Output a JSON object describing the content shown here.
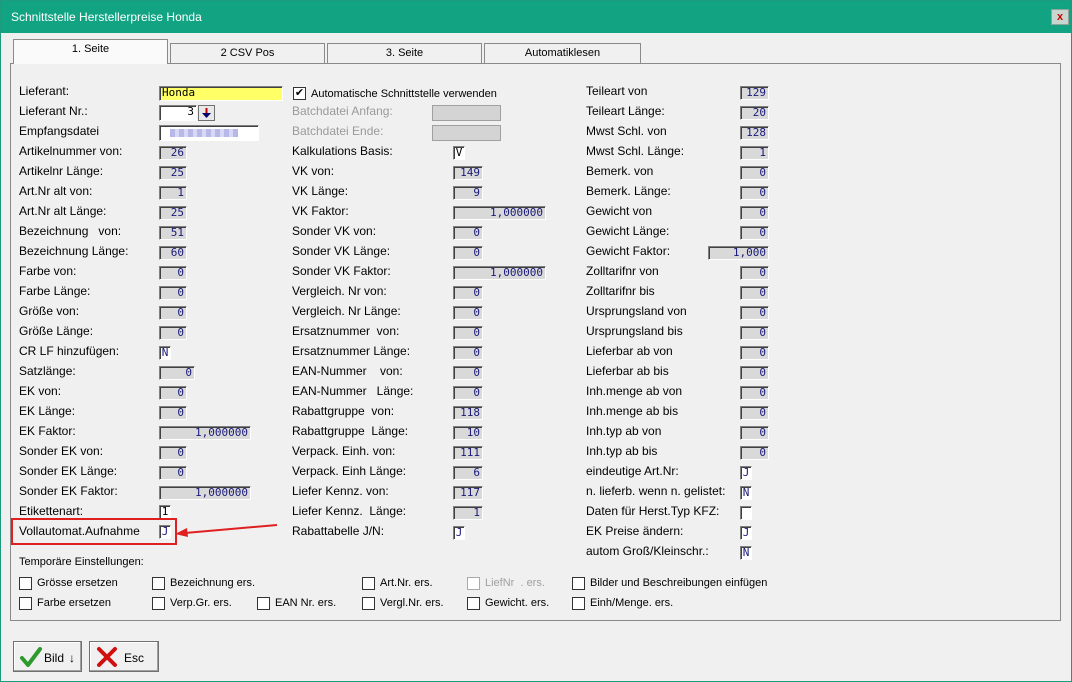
{
  "window": {
    "title": "Schnittstelle Herstellerpreise Honda",
    "close": "x"
  },
  "tabs": [
    "1. Seite",
    "2 CSV Pos",
    "3. Seite",
    "Automatiklesen"
  ],
  "col1": [
    {
      "label": "Lieferant:",
      "value": "Honda"
    },
    {
      "label": "Lieferant Nr.:",
      "value": "3"
    },
    {
      "label": "Empfangsdatei",
      "value": ""
    },
    {
      "label": "Artikelnummer von:",
      "value": "26"
    },
    {
      "label": "Artikelnr Länge:",
      "value": "25"
    },
    {
      "label": "Art.Nr alt von:",
      "value": "1"
    },
    {
      "label": "Art.Nr alt Länge:",
      "value": "25"
    },
    {
      "label": "Bezeichnung   von:",
      "value": "51"
    },
    {
      "label": "Bezeichnung Länge:",
      "value": "60"
    },
    {
      "label": "Farbe von:",
      "value": "0"
    },
    {
      "label": "Farbe Länge:",
      "value": "0"
    },
    {
      "label": "Größe von:",
      "value": "0"
    },
    {
      "label": "Größe Länge:",
      "value": "0"
    },
    {
      "label": "CR LF hinzufügen:",
      "value": "N"
    },
    {
      "label": "Satzlänge:",
      "value": "0"
    },
    {
      "label": "EK von:",
      "value": "0"
    },
    {
      "label": "EK Länge:",
      "value": "0"
    },
    {
      "label": "EK Faktor:",
      "value": "1,000000"
    },
    {
      "label": "Sonder EK von:",
      "value": "0"
    },
    {
      "label": "Sonder EK Länge:",
      "value": "0"
    },
    {
      "label": "Sonder EK Faktor:",
      "value": "1,000000"
    },
    {
      "label": "Etikettenart:",
      "value": "1"
    },
    {
      "label": "Vollautomat.Aufnahme",
      "value": "J"
    }
  ],
  "col2": {
    "auto_label": "Automatische Schnittstelle verwenden",
    "auto_checked": "✔",
    "batch_start": "Batchdatei Anfang:",
    "batch_end": "Batchdatei Ende:",
    "rows": [
      {
        "label": "Kalkulations Basis:",
        "value": "V"
      },
      {
        "label": "VK von:",
        "value": "149"
      },
      {
        "label": "VK Länge:",
        "value": "9"
      },
      {
        "label": "VK Faktor:",
        "value": "1,000000"
      },
      {
        "label": "Sonder VK von:",
        "value": "0"
      },
      {
        "label": "Sonder VK Länge:",
        "value": "0"
      },
      {
        "label": "Sonder VK Faktor:",
        "value": "1,000000"
      },
      {
        "label": "Vergleich. Nr von:",
        "value": "0"
      },
      {
        "label": "Vergleich. Nr Länge:",
        "value": "0"
      },
      {
        "label": "Ersatznummer  von:",
        "value": "0"
      },
      {
        "label": "Ersatznummer Länge:",
        "value": "0"
      },
      {
        "label": "EAN-Nummer    von:",
        "value": "0"
      },
      {
        "label": "EAN-Nummer   Länge:",
        "value": "0"
      },
      {
        "label": "Rabattgruppe  von:",
        "value": "118"
      },
      {
        "label": "Rabattgruppe  Länge:",
        "value": "10"
      },
      {
        "label": "Verpack. Einh. von:",
        "value": "111"
      },
      {
        "label": "Verpack. Einh Länge:",
        "value": "6"
      },
      {
        "label": "Liefer Kennz. von:",
        "value": "117"
      },
      {
        "label": "Liefer Kennz.  Länge:",
        "value": "1"
      },
      {
        "label": "Rabattabelle J/N:",
        "value": "J"
      }
    ]
  },
  "col3": [
    {
      "label": "Teileart von",
      "value": "129"
    },
    {
      "label": "Teileart Länge:",
      "value": "20"
    },
    {
      "label": "Mwst Schl. von",
      "value": "128"
    },
    {
      "label": "Mwst Schl. Länge:",
      "value": "1"
    },
    {
      "label": "Bemerk. von",
      "value": "0"
    },
    {
      "label": "Bemerk. Länge:",
      "value": "0"
    },
    {
      "label": "Gewicht von",
      "value": "0"
    },
    {
      "label": "Gewicht Länge:",
      "value": "0"
    },
    {
      "label": "Gewicht Faktor:",
      "value": "1,000"
    },
    {
      "label": "Zolltarifnr von",
      "value": "0"
    },
    {
      "label": "Zolltarifnr bis",
      "value": "0"
    },
    {
      "label": "Ursprungsland von",
      "value": "0"
    },
    {
      "label": "Ursprungsland bis",
      "value": "0"
    },
    {
      "label": "Lieferbar ab von",
      "value": "0"
    },
    {
      "label": "Lieferbar ab bis",
      "value": "0"
    },
    {
      "label": "Inh.menge ab von",
      "value": "0"
    },
    {
      "label": "Inh.menge ab bis",
      "value": "0"
    },
    {
      "label": "Inh.typ ab von",
      "value": "0"
    },
    {
      "label": "Inh.typ ab bis",
      "value": "0"
    },
    {
      "label": "eindeutige Art.Nr:",
      "value": "J"
    },
    {
      "label": "n. lieferb. wenn n. gelistet:",
      "value": "N"
    },
    {
      "label": "Daten für Herst.Typ KFZ:",
      "value": ""
    },
    {
      "label": "EK Preise ändern:",
      "value": "J"
    },
    {
      "label": "autom Groß/Kleinschr.:",
      "value": "N"
    }
  ],
  "temp": {
    "title": "Temporäre Einstellungen:",
    "items": [
      "Grösse ersetzen",
      "Bezeichnung ers.",
      "Art.Nr. ers.",
      "LiefNr  . ers.",
      "Bilder und Beschreibungen einfügen",
      "Farbe ersetzen",
      "Verp.Gr. ers.",
      "EAN Nr. ers.",
      "Vergl.Nr. ers.",
      "Gewicht. ers.",
      "Einh/Menge. ers."
    ]
  },
  "buttons": {
    "bild": "Bild",
    "esc": "Esc"
  }
}
